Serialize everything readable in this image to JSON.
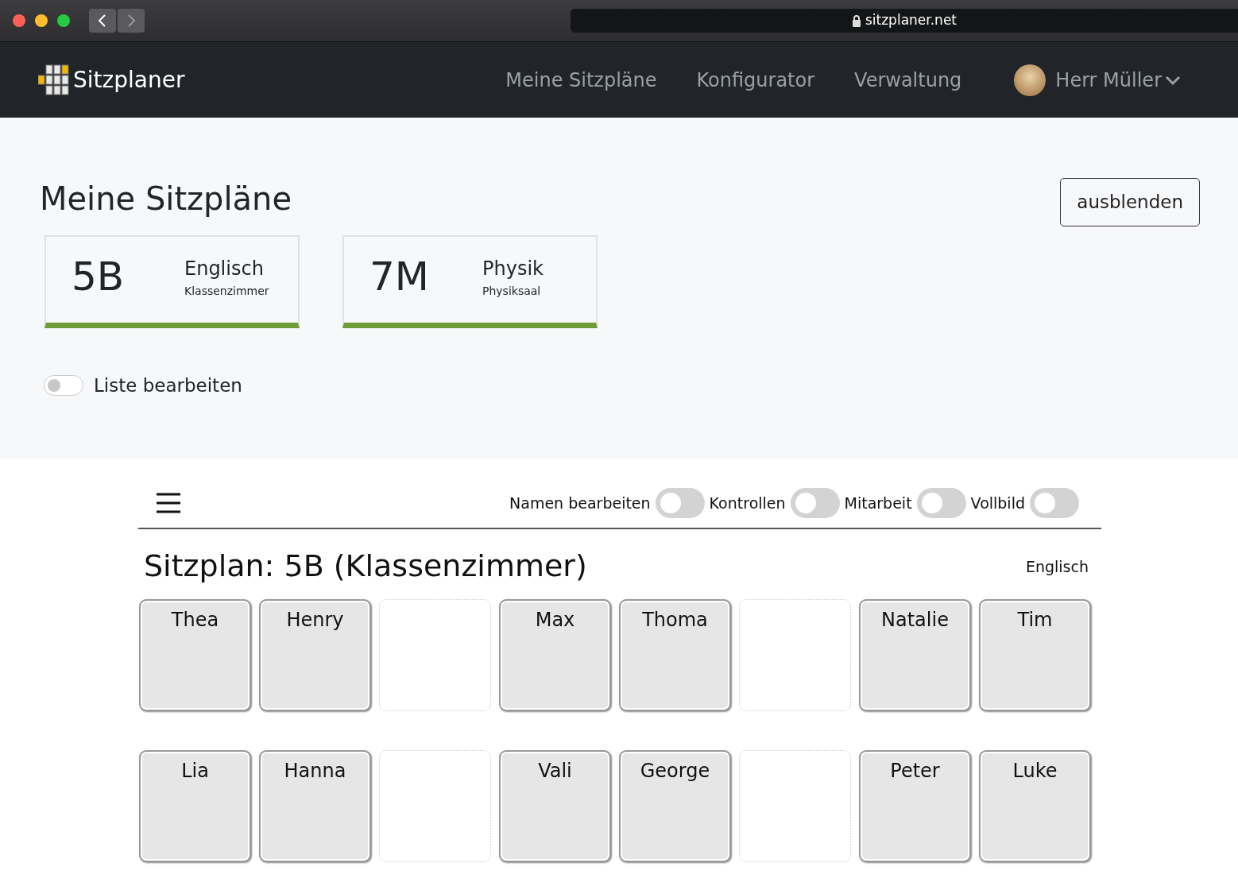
{
  "browser": {
    "url": "sitzplaner.net"
  },
  "navbar": {
    "brand": "Sitzplaner",
    "links": [
      {
        "label": "Meine Sitzpläne"
      },
      {
        "label": "Konfigurator"
      },
      {
        "label": "Verwaltung"
      }
    ],
    "user": "Herr Müller"
  },
  "overview": {
    "title": "Meine Sitzpläne",
    "hide_button": "ausblenden",
    "plans": [
      {
        "class": "5B",
        "subject": "Englisch",
        "room": "Klassenzimmer"
      },
      {
        "class": "7M",
        "subject": "Physik",
        "room": "Physiksaal"
      }
    ],
    "edit_toggle": {
      "label": "Liste bearbeiten",
      "on": false
    }
  },
  "toolbar": {
    "toggles": [
      {
        "label": "Namen bearbeiten",
        "on": false
      },
      {
        "label": "Kontrollen",
        "on": false
      },
      {
        "label": "Mitarbeit",
        "on": false
      },
      {
        "label": "Vollbild",
        "on": false
      }
    ]
  },
  "plan": {
    "title": "Sitzplan: 5B (Klassenzimmer)",
    "subject": "Englisch",
    "rows": [
      [
        {
          "kind": "student",
          "name": "Thea"
        },
        {
          "kind": "student",
          "name": "Henry"
        },
        {
          "kind": "empty"
        },
        {
          "kind": "student",
          "name": "Max"
        },
        {
          "kind": "student",
          "name": "Thoma"
        },
        {
          "kind": "empty"
        },
        {
          "kind": "student",
          "name": "Natalie"
        },
        {
          "kind": "student",
          "name": "Tim"
        }
      ],
      [
        {
          "kind": "student",
          "name": "Lia"
        },
        {
          "kind": "student",
          "name": "Hanna"
        },
        {
          "kind": "empty"
        },
        {
          "kind": "student",
          "name": "Vali"
        },
        {
          "kind": "student",
          "name": "George"
        },
        {
          "kind": "empty"
        },
        {
          "kind": "student",
          "name": "Peter"
        },
        {
          "kind": "student",
          "name": "Luke"
        }
      ]
    ]
  }
}
